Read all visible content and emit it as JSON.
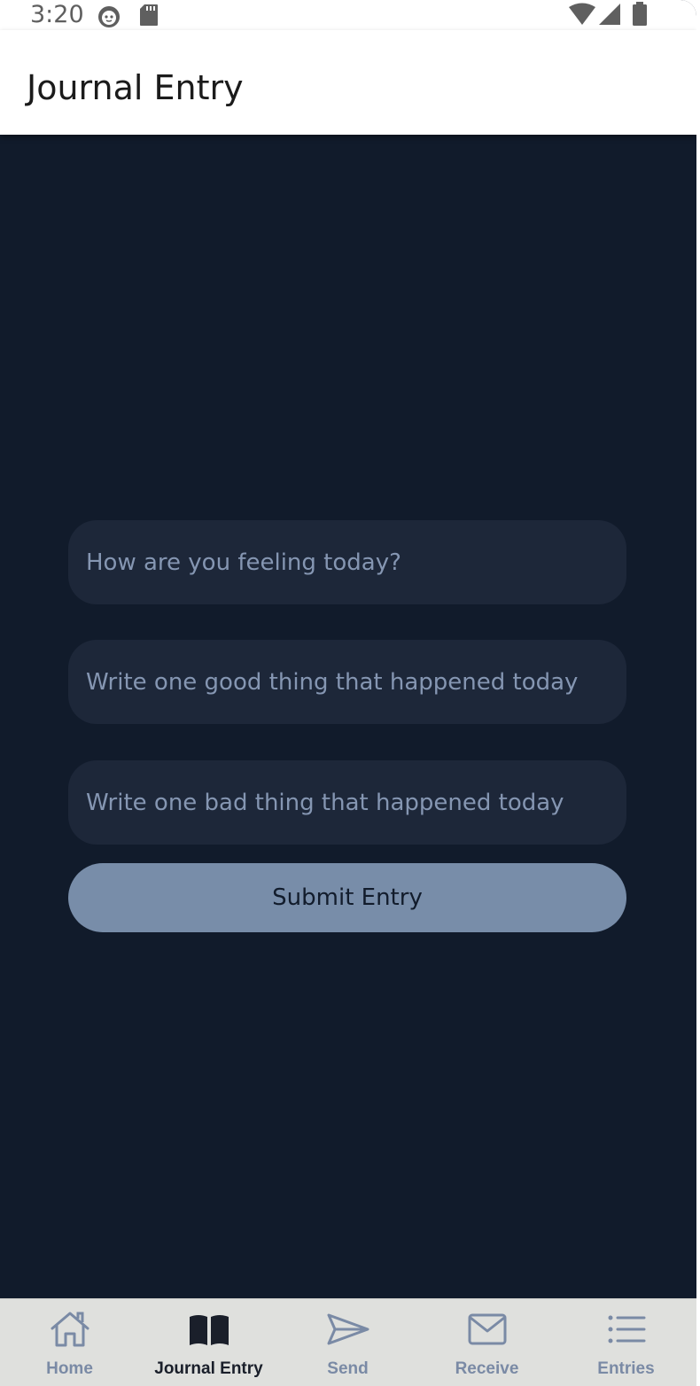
{
  "status_bar": {
    "time": "3:20",
    "left_icons": [
      "cat-face-icon",
      "sd-card-icon"
    ],
    "right_icons": [
      "wifi-icon",
      "cell-signal-icon",
      "battery-icon"
    ]
  },
  "app_bar": {
    "title": "Journal Entry"
  },
  "form": {
    "feeling": {
      "placeholder": "How are you feeling today?",
      "value": ""
    },
    "good_thing": {
      "placeholder": "Write one good thing that happened today",
      "value": ""
    },
    "bad_thing": {
      "placeholder": "Write one bad thing that happened today",
      "value": ""
    },
    "submit_label": "Submit Entry"
  },
  "bottom_nav": {
    "items": [
      {
        "label": "Home",
        "icon": "home-icon",
        "active": false
      },
      {
        "label": "Journal Entry",
        "icon": "book-open-icon",
        "active": true
      },
      {
        "label": "Send",
        "icon": "send-icon",
        "active": false
      },
      {
        "label": "Receive",
        "icon": "mail-icon",
        "active": false
      },
      {
        "label": "Entries",
        "icon": "list-icon",
        "active": false
      }
    ]
  },
  "colors": {
    "background": "#111b2b",
    "field": "#1d2739",
    "placeholder": "#8596b2",
    "button": "#788da9",
    "nav_background": "#dfe0dd",
    "nav_inactive": "#7a8aa5",
    "nav_active": "#1a1f2a"
  }
}
